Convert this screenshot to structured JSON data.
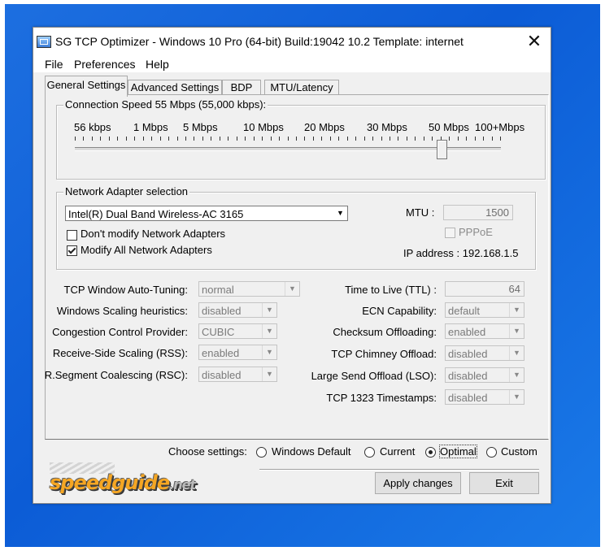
{
  "window": {
    "title": "SG TCP Optimizer - Windows 10 Pro (64-bit) Build:19042 10.2  Template: internet",
    "close_glyph": "✕"
  },
  "menu": [
    "File",
    "Preferences",
    "Help"
  ],
  "tabs": [
    "General Settings",
    "Advanced Settings",
    "BDP",
    "MTU/Latency"
  ],
  "connection_speed": {
    "legend": "Connection Speed  55 Mbps (55,000 kbps):",
    "tick_labels": [
      "56 kbps",
      "1 Mbps",
      "5 Mbps",
      "10 Mbps",
      "20 Mbps",
      "30 Mbps",
      "50 Mbps",
      "100+Mbps"
    ],
    "slider_value_fraction": 0.86
  },
  "adapter": {
    "legend": "Network Adapter selection",
    "selected": "Intel(R) Dual Band Wireless-AC 3165",
    "dont_modify_label": "Don't modify Network Adapters",
    "dont_modify_checked": false,
    "modify_all_label": "Modify All Network Adapters",
    "modify_all_checked": true,
    "mtu_label": "MTU :",
    "mtu_value": "1500",
    "pppoe_label": "PPPoE",
    "ip_label": "IP address : 192.168.1.5"
  },
  "left_settings": [
    {
      "label": "TCP Window Auto-Tuning:",
      "value": "normal"
    },
    {
      "label": "Windows Scaling heuristics:",
      "value": "disabled"
    },
    {
      "label": "Congestion Control Provider:",
      "value": "CUBIC"
    },
    {
      "label": "Receive-Side Scaling (RSS):",
      "value": "enabled"
    },
    {
      "label": "R.Segment Coalescing (RSC):",
      "value": "disabled"
    }
  ],
  "right_settings": {
    "ttl_label": "Time to Live (TTL) :",
    "ttl_value": "64",
    "items": [
      {
        "label": "ECN Capability:",
        "value": "default"
      },
      {
        "label": "Checksum Offloading:",
        "value": "enabled"
      },
      {
        "label": "TCP Chimney Offload:",
        "value": "disabled"
      },
      {
        "label": "Large Send Offload (LSO):",
        "value": "disabled"
      },
      {
        "label": "TCP 1323 Timestamps:",
        "value": "disabled"
      }
    ]
  },
  "choose": {
    "label": "Choose settings:",
    "options": [
      "Windows Default",
      "Current",
      "Optimal",
      "Custom"
    ],
    "selected": "Optimal"
  },
  "buttons": {
    "apply": "Apply changes",
    "exit": "Exit"
  },
  "logo": {
    "main": "speedguide",
    "suffix": ".net"
  },
  "colors": {
    "desktop": "#0c5cd6",
    "logo": "#f5a623"
  }
}
